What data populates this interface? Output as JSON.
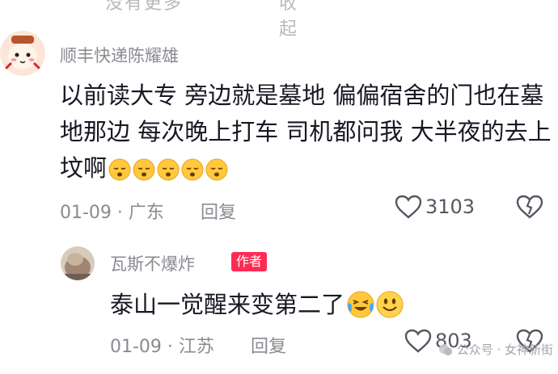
{
  "cutoff_top": {
    "left_text": "没有更多",
    "right_text": "收起"
  },
  "comments": [
    {
      "username": "顺丰快递陈耀雄",
      "text": "以前读大专 旁边就是墓地 偏偏宿舍的门也在墓地那边 每次晚上打车 司机都问我 大半夜的去上坟啊",
      "emoji": "sleepy-face-emoji",
      "emoji_count": 5,
      "date": "01-09",
      "location": "广东",
      "reply_label": "回复",
      "likes": "3103"
    },
    {
      "username": "瓦斯不爆炸",
      "badge": "作者",
      "text": "泰山一觉醒来变第二了",
      "emojis": [
        "crying-laughing-emoji",
        "grinning-face-emoji"
      ],
      "date": "01-09",
      "location": "江苏",
      "reply_label": "回复",
      "likes": "803"
    }
  ],
  "watermark": "公众号 · 女神新街"
}
